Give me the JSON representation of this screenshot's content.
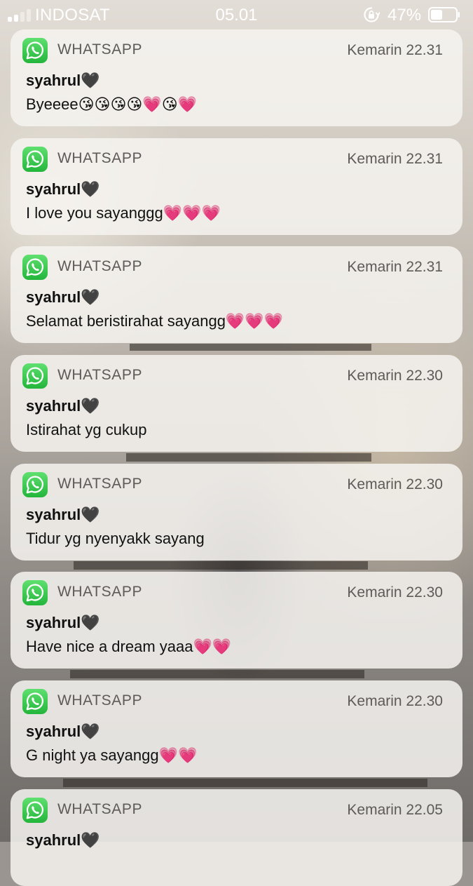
{
  "status_bar": {
    "carrier": "INDOSAT",
    "time": "05.01",
    "battery_percent": "47%",
    "signal_bars_filled": 2,
    "signal_bars_total": 4,
    "battery_level": 0.47
  },
  "notifications": [
    {
      "app": "WHATSAPP",
      "time": "Kemarin 22.31",
      "sender": "syahrul🖤",
      "message": "Byeeee😘😘😘😘💗😘💗"
    },
    {
      "app": "WHATSAPP",
      "time": "Kemarin 22.31",
      "sender": "syahrul🖤",
      "message": "I love you sayanggg💗💗💗"
    },
    {
      "app": "WHATSAPP",
      "time": "Kemarin 22.31",
      "sender": "syahrul🖤",
      "message": "Selamat beristirahat sayangg💗💗💗"
    },
    {
      "app": "WHATSAPP",
      "time": "Kemarin 22.30",
      "sender": "syahrul🖤",
      "message": "Istirahat yg cukup"
    },
    {
      "app": "WHATSAPP",
      "time": "Kemarin 22.30",
      "sender": "syahrul🖤",
      "message": "Tidur yg nyenyakk sayang"
    },
    {
      "app": "WHATSAPP",
      "time": "Kemarin 22.30",
      "sender": "syahrul🖤",
      "message": "Have nice a dream yaaa💗💗"
    },
    {
      "app": "WHATSAPP",
      "time": "Kemarin 22.30",
      "sender": "syahrul🖤",
      "message": "G night ya sayangg💗💗"
    },
    {
      "app": "WHATSAPP",
      "time": "Kemarin 22.05",
      "sender": "syahrul🖤",
      "message": ""
    }
  ],
  "colors": {
    "whatsapp_green": "#25D366",
    "card_background": "#f6f3f0"
  },
  "icons": {
    "app_icon": "whatsapp-icon",
    "status": [
      "signal-icon",
      "rotation-lock-icon",
      "battery-icon"
    ]
  }
}
